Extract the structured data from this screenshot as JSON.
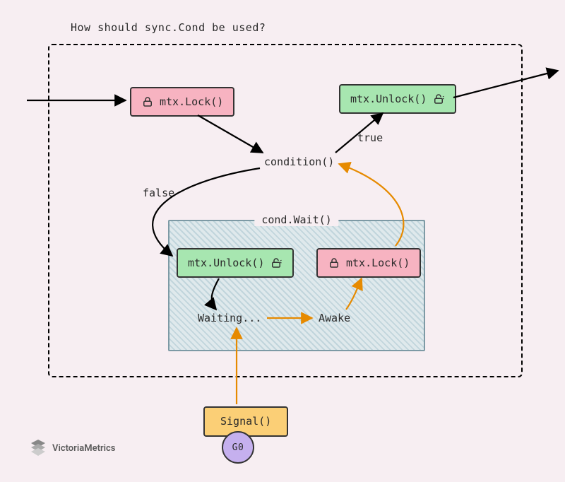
{
  "title": "How should sync.Cond be used?",
  "nodes": {
    "lock1": {
      "text": "mtx.Lock()"
    },
    "unlock1": {
      "text": "mtx.Unlock()"
    },
    "unlock2": {
      "text": "mtx.Unlock()"
    },
    "lock2": {
      "text": "mtx.Lock()"
    },
    "condition": "condition()",
    "cond_wait": "cond.Wait()",
    "waiting": "Waiting...",
    "awake": "Awake",
    "signal": "Signal()",
    "goroutine_label": "G0"
  },
  "edges": {
    "true_label": "true",
    "false_label": "false"
  },
  "brand": "VictoriaMetrics"
}
